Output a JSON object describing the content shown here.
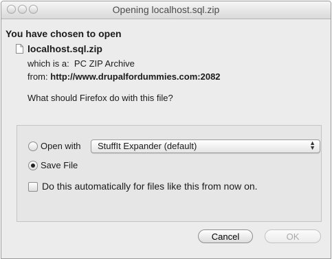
{
  "window": {
    "title": "Opening localhost.sql.zip"
  },
  "dialog": {
    "heading": "You have chosen to open",
    "file_name": "localhost.sql.zip",
    "type_line": "which is a:  PC ZIP Archive",
    "from_prefix": "from:",
    "from_url": "http://www.drupalfordummies.com:2082",
    "question": "What should Firefox do with this file?"
  },
  "options": {
    "open_with_label": "Open with",
    "open_with_selected": false,
    "app_selected": "StuffIt Expander (default)",
    "save_label": "Save File",
    "save_selected": true,
    "auto_label": "Do this automatically for files like this from now on.",
    "auto_checked": false
  },
  "buttons": {
    "cancel": "Cancel",
    "ok": "OK"
  },
  "icons": {
    "close": "close-light-icon",
    "minimize": "minimize-light-icon",
    "zoom": "zoom-light-icon",
    "file": "document-icon",
    "select_arrows": "up-down-arrows-icon"
  }
}
